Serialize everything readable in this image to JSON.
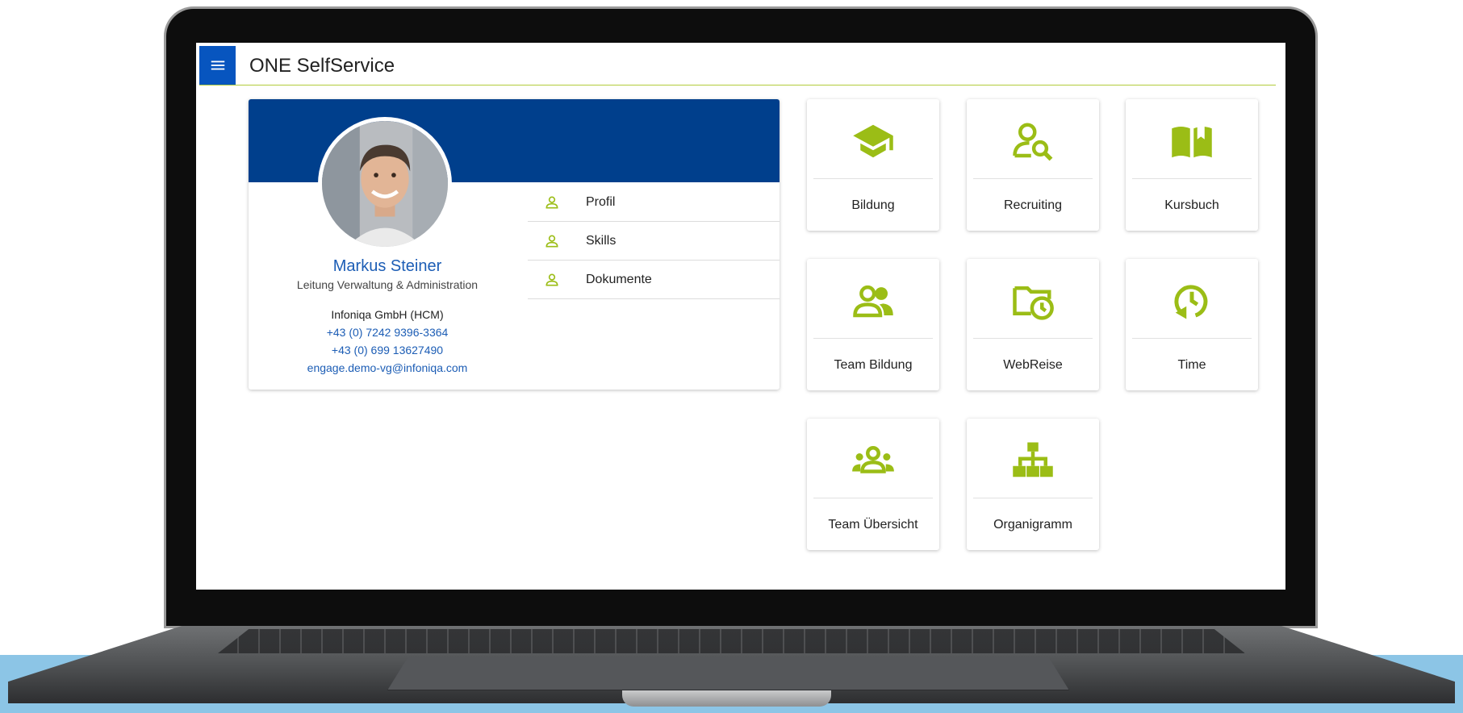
{
  "app": {
    "title": "ONE SelfService",
    "accent_color": "#9bbd16",
    "header_color": "#003f8c",
    "menu_button_color": "#0755bf"
  },
  "profile": {
    "name": "Markus Steiner",
    "role": "Leitung Verwaltung & Administration",
    "company": "Infoniqa GmbH (HCM)",
    "phone1": "+43 (0) 7242 9396-3364",
    "phone2": "+43 (0) 699 13627490",
    "email": "engage.demo-vg@infoniqa.com",
    "menu": [
      {
        "label": "Profil",
        "icon": "person-icon"
      },
      {
        "label": "Skills",
        "icon": "person-icon"
      },
      {
        "label": "Dokumente",
        "icon": "person-icon"
      }
    ]
  },
  "tiles": [
    {
      "label": "Bildung",
      "icon": "graduation-cap-icon"
    },
    {
      "label": "Recruiting",
      "icon": "person-search-icon"
    },
    {
      "label": "Kursbuch",
      "icon": "open-book-icon"
    },
    {
      "label": "Team Bildung",
      "icon": "people-icon"
    },
    {
      "label": "WebReise",
      "icon": "folder-clock-icon"
    },
    {
      "label": "Time",
      "icon": "clock-history-icon"
    },
    {
      "label": "Team Übersicht",
      "icon": "groups-icon"
    },
    {
      "label": "Organigramm",
      "icon": "org-chart-icon"
    }
  ]
}
